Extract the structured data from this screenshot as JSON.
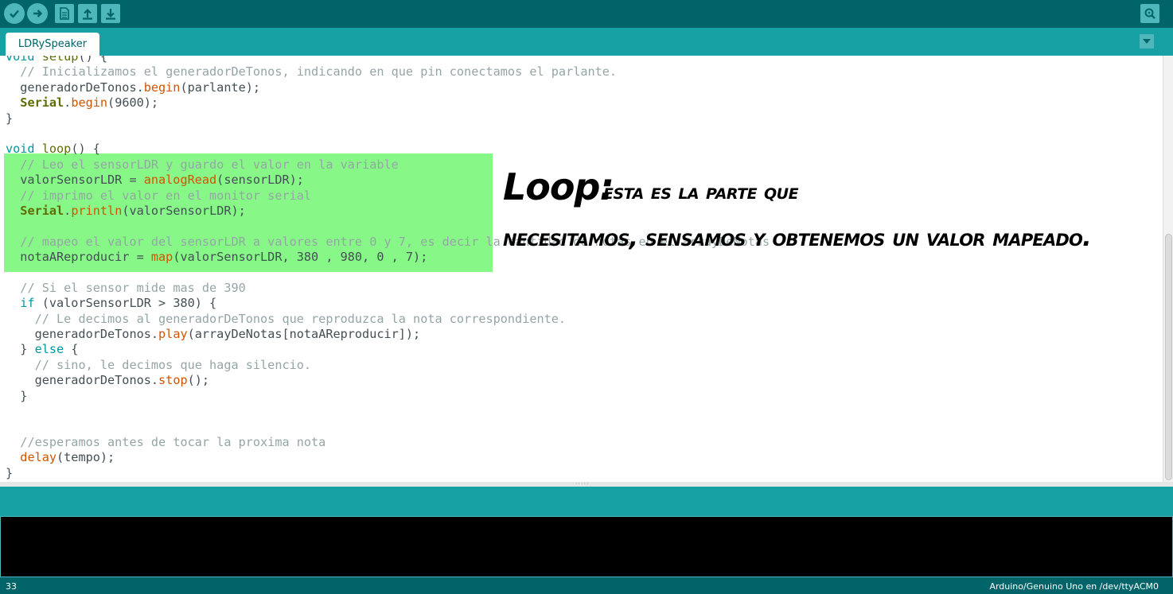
{
  "toolbar": {
    "buttons": [
      {
        "name": "verify-button",
        "icon": "checkmark-icon"
      },
      {
        "name": "upload-button",
        "icon": "arrow-right-icon"
      },
      {
        "name": "new-button",
        "icon": "new-file-icon"
      },
      {
        "name": "open-button",
        "icon": "arrow-up-icon"
      },
      {
        "name": "save-button",
        "icon": "arrow-down-icon"
      }
    ],
    "serial_monitor_icon": "magnifier-icon"
  },
  "tab": {
    "label": "LDRySpeaker",
    "menu_icon": "triangle-down-icon"
  },
  "code_lines": [
    "void setup() {",
    "  // Inicializamos el generadorDeTonos, indicando en que pin conectamos el parlante.",
    "  generadorDeTonos.begin(parlante);",
    "  Serial.begin(9600);",
    "}",
    "",
    "void loop() {",
    "  // Leo el sensorLDR y guardo el valor en la variable",
    "  valorSensorLDR = analogRead(sensorLDR);",
    "  // imprimo el valor en el monitor serial",
    "  Serial.println(valorSensorLDR);",
    "",
    "  // mapeo el valor del sensorLDR a valores entre 0 y 7, es decir la cantidad de notas en el arrayDeNotas",
    "  notaAReproducir = map(valorSensorLDR, 380 , 980, 0 , 7);",
    "",
    "  // Si el sensor mide mas de 390",
    "  if (valorSensorLDR > 380) {",
    "    // Le decimos al generadorDeTonos que reproduzca la nota correspondiente.",
    "    generadorDeTonos.play(arrayDeNotas[notaAReproducir]);",
    "  } else {",
    "    // sino, le decimos que haga silencio.",
    "    generadorDeTonos.stop();",
    "  }",
    "",
    "",
    "  //esperamos antes de tocar la proxima nota",
    "  delay(tempo);",
    "}"
  ],
  "annotation": {
    "title": "Loop:",
    "line1": "esta es la parte que",
    "line2": "necesitamos, sensamos y obtenemos un valor mapeado."
  },
  "status": {
    "line_number": "33",
    "board": "Arduino/Genuino Uno en /dev/ttyACM0"
  },
  "colors": {
    "toolbar": "#006468",
    "tabbar": "#17a1a5",
    "highlight": "#87f887",
    "keyword": "#00979c",
    "function": "#d35400",
    "comment": "#95a5a6"
  }
}
